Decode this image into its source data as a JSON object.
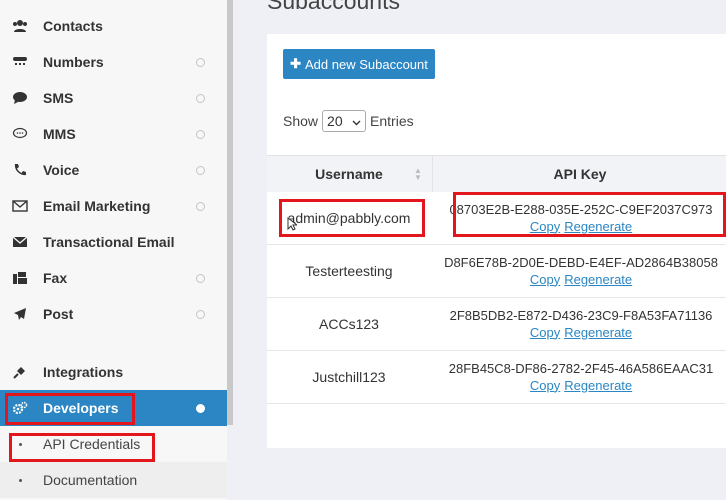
{
  "sidebar": {
    "items": [
      {
        "label": "Contacts",
        "icon": "contacts-icon",
        "dot": false
      },
      {
        "label": "Numbers",
        "icon": "numbers-icon",
        "dot": true
      },
      {
        "label": "SMS",
        "icon": "sms-icon",
        "dot": true
      },
      {
        "label": "MMS",
        "icon": "mms-icon",
        "dot": true
      },
      {
        "label": "Voice",
        "icon": "phone-icon",
        "dot": true
      },
      {
        "label": "Email Marketing",
        "icon": "email-marketing-icon",
        "dot": true
      },
      {
        "label": "Transactional Email",
        "icon": "transactional-email-icon",
        "dot": false
      },
      {
        "label": "Fax",
        "icon": "fax-icon",
        "dot": true
      },
      {
        "label": "Post",
        "icon": "post-icon",
        "dot": true
      },
      {
        "label": "Integrations",
        "icon": "plug-icon",
        "dot": false
      },
      {
        "label": "Developers",
        "icon": "gears-icon",
        "dot": true,
        "active": true
      }
    ],
    "subitems": [
      {
        "label": "API Credentials"
      },
      {
        "label": "Documentation"
      }
    ]
  },
  "main": {
    "title": "Subaccounts",
    "add_button_label": "Add new Subaccount",
    "show_label": "Show",
    "entries_value": "20",
    "entries_label": "Entries",
    "columns": [
      "Username",
      "API Key"
    ],
    "rows": [
      {
        "username": "admin@pabbly.com",
        "api_key": "08703E2B-E288-035E-252C-C9EF2037C973",
        "copy": "Copy",
        "regenerate": "Regenerate"
      },
      {
        "username": "Testerteesting",
        "api_key": "D8F6E78B-2D0E-DEBD-E4EF-AD2864B38058",
        "copy": "Copy",
        "regenerate": "Regenerate"
      },
      {
        "username": "ACCs123",
        "api_key": "2F8B5DB2-E872-D436-23C9-F8A53FA71136",
        "copy": "Copy",
        "regenerate": "Regenerate"
      },
      {
        "username": "Justchill123",
        "api_key": "28FB45C8-DF86-2782-2F45-46A586EAAC31",
        "copy": "Copy",
        "regenerate": "Regenerate"
      }
    ]
  },
  "colors": {
    "accent": "#2b86c3",
    "highlight": "#e3161e"
  }
}
